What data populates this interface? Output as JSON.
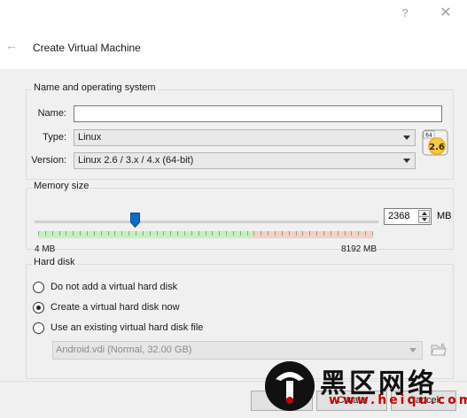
{
  "window": {
    "help_glyph": "?",
    "close_glyph": "✕"
  },
  "header": {
    "back_glyph": "←",
    "title": "Create Virtual Machine"
  },
  "os_section": {
    "title": "Name and operating system",
    "name_label": "Name:",
    "name_value": "",
    "type_label": "Type:",
    "type_value": "Linux",
    "version_label": "Version:",
    "version_value": "Linux 2.6 / 3.x / 4.x (64-bit)",
    "os_icon": {
      "name": "linux-26-64bit-icon",
      "badge_top": "64",
      "badge_main": "2.6"
    }
  },
  "memory_section": {
    "title": "Memory size",
    "min_label": "4 MB",
    "max_label": "8192 MB",
    "value": "2368",
    "unit": "MB",
    "slider": {
      "min": 4,
      "max": 8192,
      "value": 2368,
      "safe_limit_fraction": 0.64
    }
  },
  "disk_section": {
    "title": "Hard disk",
    "options": [
      {
        "label": "Do not add a virtual hard disk",
        "checked": false
      },
      {
        "label": "Create a virtual hard disk now",
        "checked": true
      },
      {
        "label": "Use an existing virtual hard disk file",
        "checked": false
      }
    ],
    "existing_disk_value": "Android.vdi (Normal, 32.00 GB)"
  },
  "footer": {
    "guided_label": "Gui",
    "create_label": "Create",
    "cancel_label": "Cancel"
  },
  "watermark": {
    "text": "黑区网络",
    "url": "www.heiqu.com"
  },
  "colors": {
    "accent": "#0b6bcb",
    "green_band": "#c7f0c1",
    "red_band": "#f6cfc8"
  }
}
